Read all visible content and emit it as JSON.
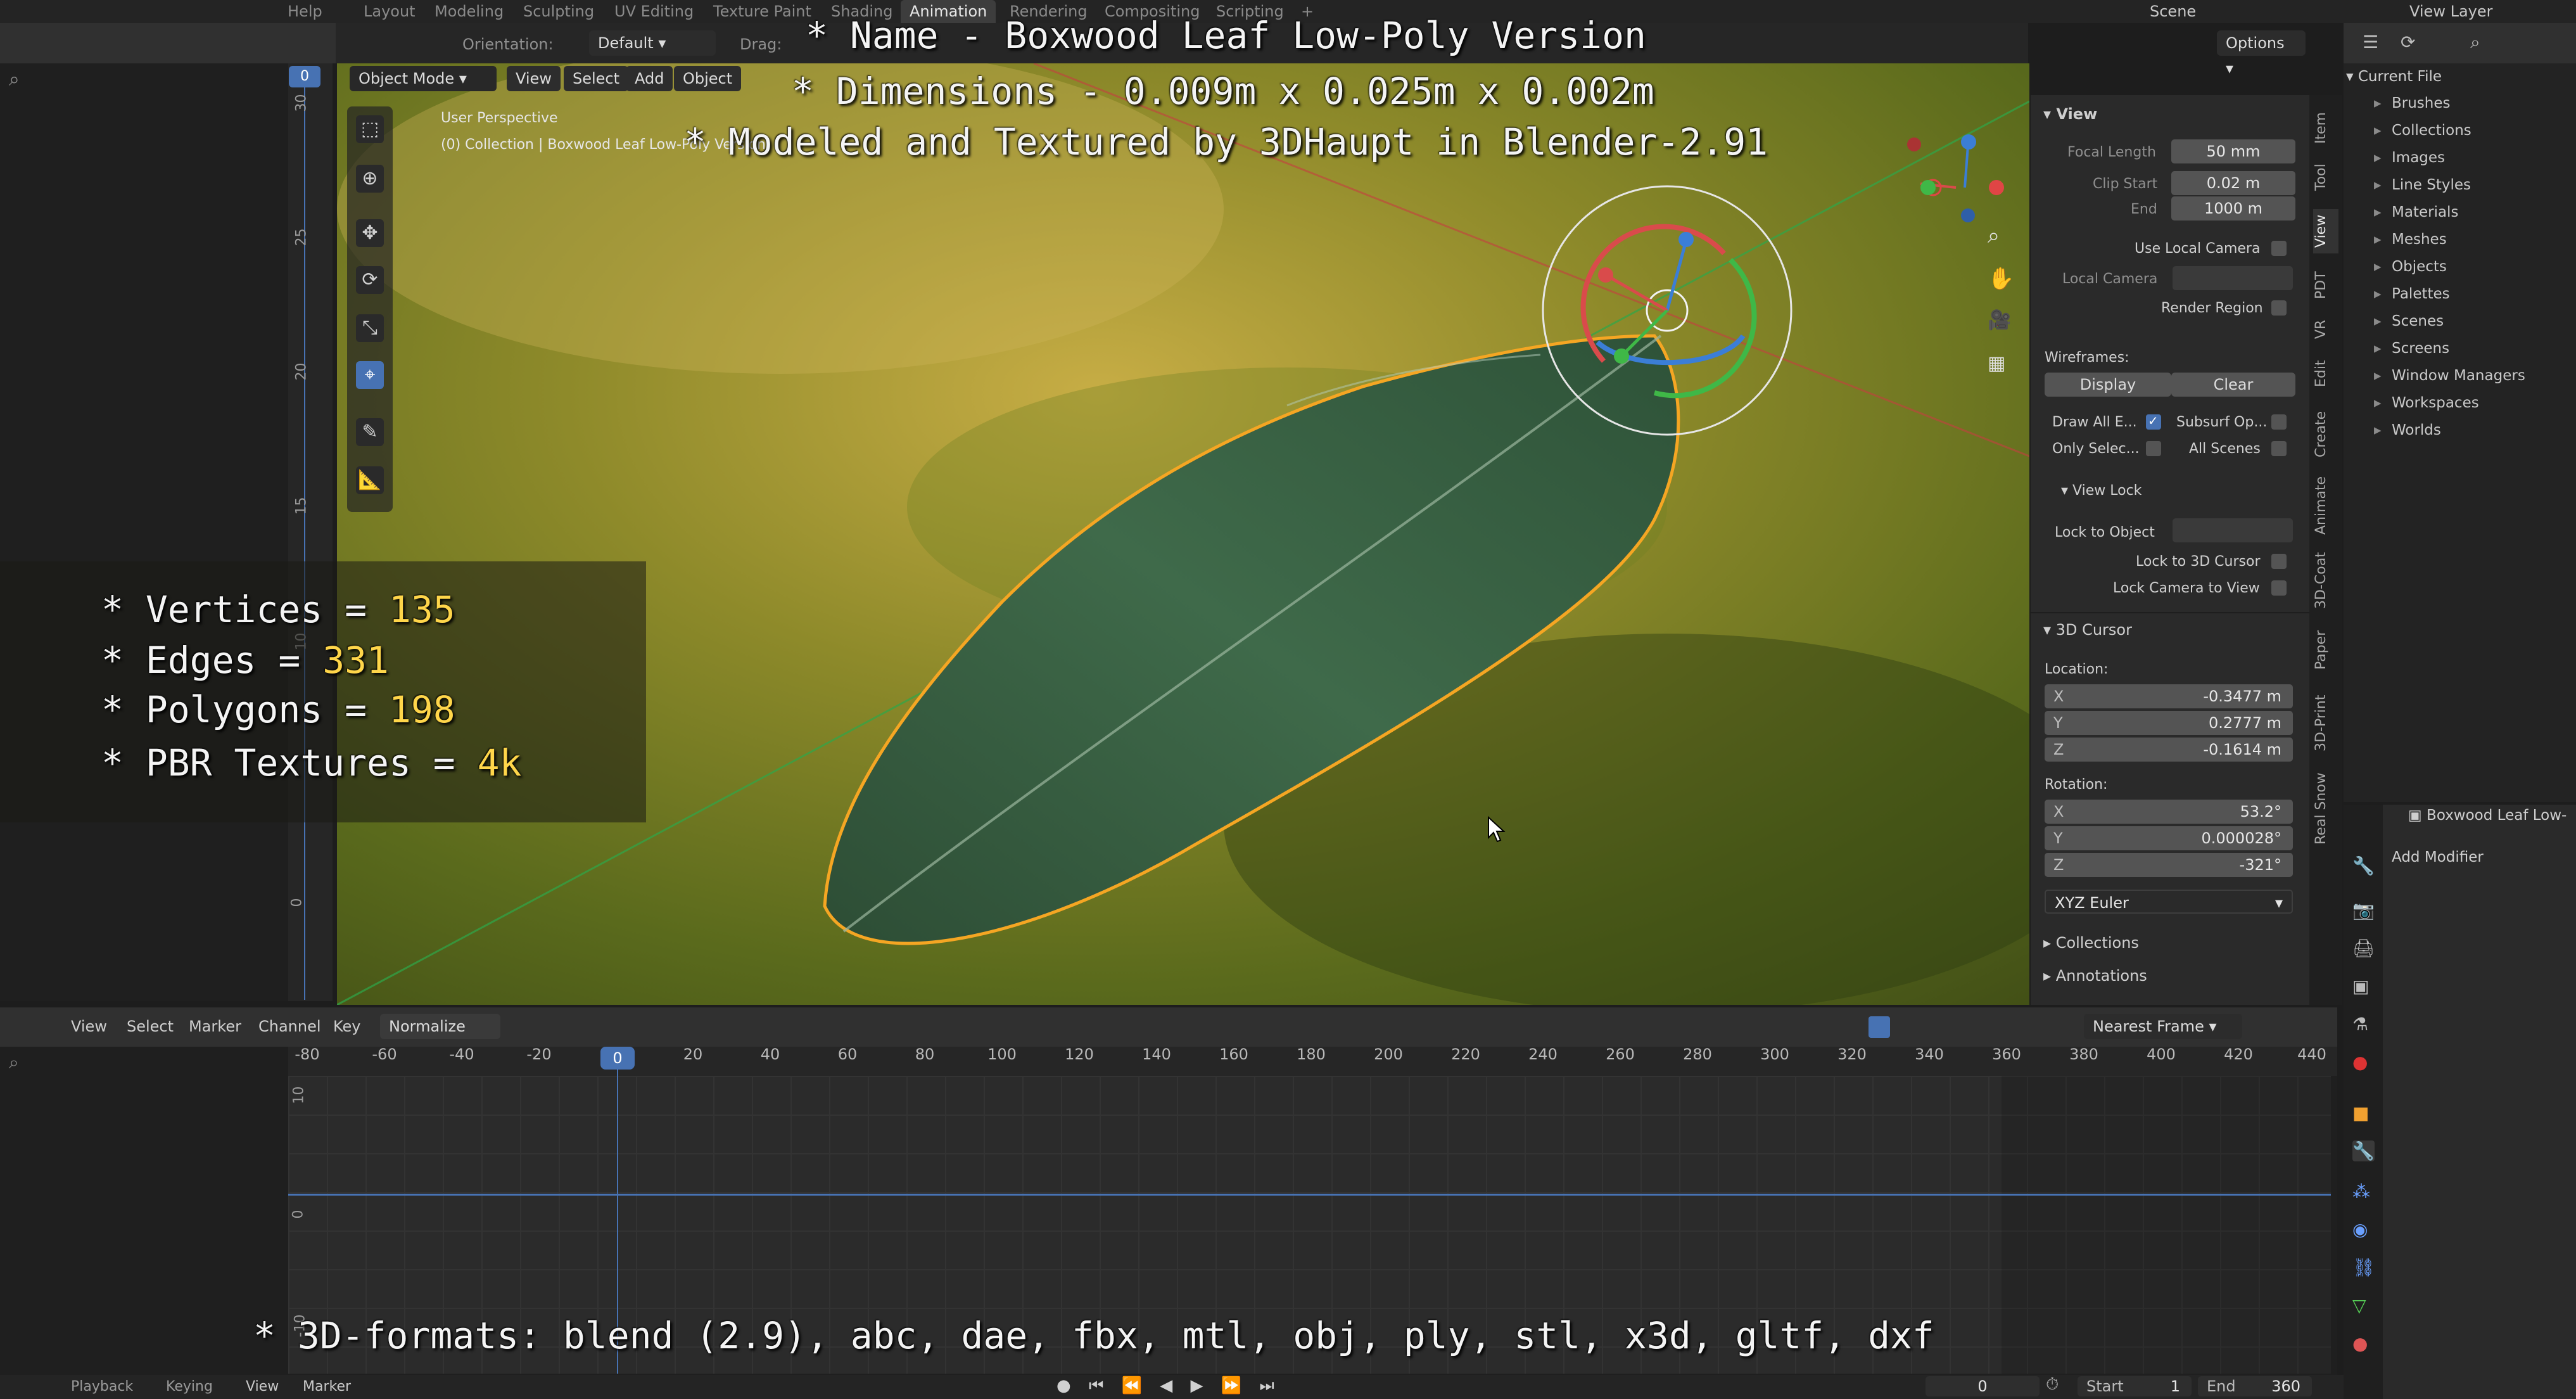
{
  "topbar": {
    "app_menu": "Help",
    "tabs": [
      "Layout",
      "Modeling",
      "Sculpting",
      "UV Editing",
      "Texture Paint",
      "Shading",
      "Animation",
      "Rendering",
      "Compositing",
      "Scripting",
      "+"
    ],
    "active_tab": "Animation",
    "scene": "Scene",
    "view_layer": "View Layer"
  },
  "viewport_header": {
    "orientation_label": "Orientation:",
    "orientation_value": "Default",
    "drag_label": "Drag:",
    "options": "Options",
    "mode": "Object Mode",
    "menu": [
      "View",
      "Select",
      "Add",
      "Object"
    ],
    "perspective": "User Perspective",
    "collection": "(0) Collection | Boxwood Leaf Low-Poly Version"
  },
  "overlay": {
    "name": "* Name - Boxwood Leaf Low-Poly Version",
    "dimensions": "* Dimensions -  0.009m x 0.025m x 0.002m",
    "modeled": "* Modeled and Textured by 3DHaupt in Blender-2.91",
    "formats": "* 3D-formats: blend (2.9), abc, dae, fbx, mtl, obj, ply, stl, x3d, gltf, dxf"
  },
  "stats": [
    {
      "label": "* Vertices = ",
      "value": "135"
    },
    {
      "label": "* Edges = ",
      "value": "331"
    },
    {
      "label": "* Polygons = ",
      "value": "198"
    },
    {
      "label": "* PBR Textures = ",
      "value": "4k"
    }
  ],
  "view_panel": {
    "title": "View",
    "focal_length_label": "Focal Length",
    "focal_length": "50 mm",
    "clip_start_label": "Clip Start",
    "clip_start": "0.02 m",
    "end_label": "End",
    "end": "1000 m",
    "use_local_camera": "Use Local Camera",
    "local_camera": "Local Camera",
    "render_region": "Render Region",
    "wireframes": "Wireframes:",
    "display": "Display",
    "clear": "Clear",
    "draw_all": "Draw All E...",
    "subsurf": "Subsurf Op...",
    "only_selec": "Only Selec...",
    "all_scenes": "All Scenes",
    "view_lock": "View Lock",
    "lock_to_object": "Lock to Object",
    "lock_3d_cursor": "Lock to 3D Cursor",
    "lock_camera": "Lock Camera to View",
    "cursor_title": "3D Cursor",
    "location": "Location:",
    "loc": [
      {
        "axis": "X",
        "value": "-0.3477 m"
      },
      {
        "axis": "Y",
        "value": "0.2777 m"
      },
      {
        "axis": "Z",
        "value": "-0.1614 m"
      }
    ],
    "rotation": "Rotation:",
    "rot": [
      {
        "axis": "X",
        "value": "53.2°"
      },
      {
        "axis": "Y",
        "value": "0.000028°"
      },
      {
        "axis": "Z",
        "value": "-321°"
      }
    ],
    "rot_mode": "XYZ Euler",
    "collections": "Collections",
    "annotations": "Annotations"
  },
  "side_tabs": [
    "Item",
    "Tool",
    "View",
    "PDT",
    "VR",
    "Edit",
    "Create",
    "Animate",
    "3D-Coat",
    "Paper",
    "3D-Print",
    "Real Snow"
  ],
  "outliner": {
    "current_file": "Current File",
    "items": [
      "Brushes",
      "Collections",
      "Images",
      "Line Styles",
      "Materials",
      "Meshes",
      "Objects",
      "Palettes",
      "Scenes",
      "Screens",
      "Window Managers",
      "Workspaces",
      "Worlds"
    ]
  },
  "properties": {
    "object_name": "Boxwood Leaf Low-",
    "add_modifier": "Add Modifier"
  },
  "timeline": {
    "menu": [
      "View",
      "Select",
      "Marker",
      "Channel",
      "Key"
    ],
    "normalize": "Normalize",
    "snap": "Nearest Frame",
    "frame_ticks": [
      "-80",
      "-60",
      "-40",
      "-20",
      "0",
      "20",
      "40",
      "60",
      "80",
      "100",
      "120",
      "140",
      "160",
      "180",
      "200",
      "220",
      "240",
      "260",
      "280",
      "300",
      "320",
      "340",
      "360",
      "380",
      "400",
      "420",
      "440"
    ],
    "value_ticks": [
      "10",
      "0",
      "-10"
    ],
    "current_frame": "0"
  },
  "left_ruler": {
    "ticks": [
      "30",
      "25",
      "20",
      "15",
      "10",
      "0"
    ],
    "current": "0"
  },
  "bottom_bar": {
    "menu": [
      "Playback",
      "Keying",
      "View",
      "Marker"
    ],
    "frame": "0",
    "start_label": "Start",
    "start": "1",
    "end_label": "End",
    "end": "360"
  },
  "colors": {
    "accent": "#4772b3",
    "selection_outline": "#f5a623",
    "playhead": "#4772b3",
    "stat_value": "#ffd64a"
  }
}
